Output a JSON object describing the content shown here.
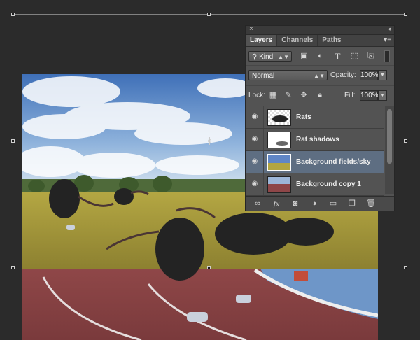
{
  "panel": {
    "close_icon": "×",
    "collapse_icon": "‹‹",
    "menu_icon": "▾≡",
    "tabs": [
      {
        "label": "Layers",
        "active": true
      },
      {
        "label": "Channels",
        "active": false
      },
      {
        "label": "Paths",
        "active": false
      }
    ],
    "filter": {
      "kind_label": "Kind",
      "icons": [
        "image-filter-icon",
        "adjustment-filter-icon",
        "type-filter-icon",
        "shape-filter-icon",
        "smart-object-filter-icon"
      ]
    },
    "blend_mode": "Normal",
    "opacity_label": "Opacity:",
    "opacity_value": "100%",
    "lock_label": "Lock:",
    "fill_label": "Fill:",
    "fill_value": "100%",
    "layers": [
      {
        "name": "Rats",
        "selected": false,
        "visible": true
      },
      {
        "name": "Rat shadows",
        "selected": false,
        "visible": true
      },
      {
        "name": "Background fields/sky",
        "selected": true,
        "visible": true
      },
      {
        "name": "Background copy 1",
        "selected": false,
        "visible": true
      }
    ],
    "bottom_icons": [
      "link-layers-icon",
      "fx-icon",
      "add-mask-icon",
      "adjustment-layer-icon",
      "new-group-icon",
      "new-layer-icon",
      "trash-icon"
    ],
    "fx_label": "fx"
  },
  "colors": {
    "panel_bg": "#535353",
    "selected_row": "#5e6e82",
    "workspace": "#2b2b2b"
  }
}
